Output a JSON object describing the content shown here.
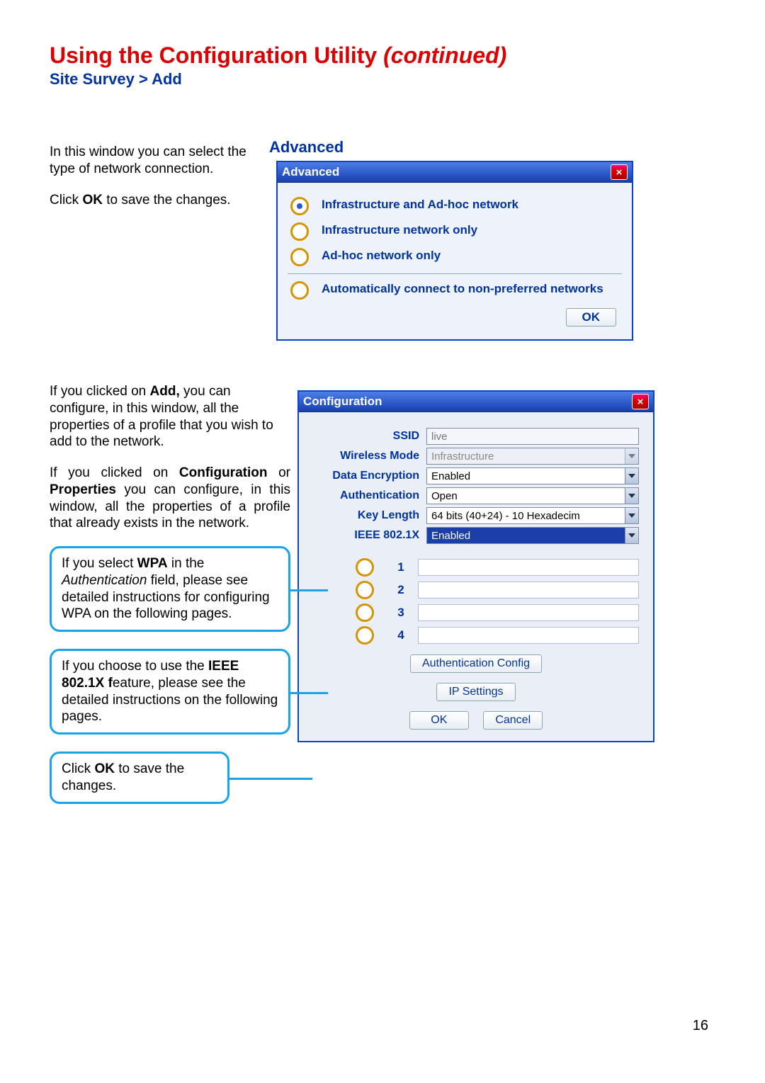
{
  "title_main": "Using the Configuration Utility ",
  "title_italic": "(continued)",
  "breadcrumb": "Site Survey > Add",
  "section_advanced": "Advanced",
  "intro1": "In this window you can select the type of network connection.",
  "intro2_pre": "Click ",
  "intro2_bold": "OK",
  "intro2_post": " to save the changes.",
  "adv": {
    "title": "Advanced",
    "opt1": "Infrastructure and Ad-hoc network",
    "opt2": "Infrastructure  network only",
    "opt3": "Ad-hoc network only",
    "opt4": "Automatically connect to non-preferred networks",
    "ok": "OK"
  },
  "para_add_pre": "If you clicked on ",
  "para_add_bold": "Add,",
  "para_add_post": " you can configure, in this window, all the properties of a profile that you wish to add to the network.",
  "para_cfg_pre": "If you clicked on ",
  "para_cfg_b1": "Configuration",
  "para_cfg_mid": " or ",
  "para_cfg_b2": "Properties",
  "para_cfg_post": " you can configure, in this window, all the properties of a profile that already exists in the network.",
  "callout_wpa_pre": "If you select ",
  "callout_wpa_bold": "WPA",
  "callout_wpa_mid": " in the ",
  "callout_wpa_italic": "Authentication",
  "callout_wpa_post": " field, please see detailed instructions for configuring WPA on the following pages.",
  "callout_ieee_pre": "If you choose to use the ",
  "callout_ieee_bold": "IEEE 802.1X f",
  "callout_ieee_post": "eature, please see the detailed instructions on the following pages.",
  "callout_ok_pre": "Click ",
  "callout_ok_bold": "OK",
  "callout_ok_post": " to save the changes.",
  "cfg": {
    "title": "Configuration",
    "labels": {
      "ssid": "SSID",
      "mode": "Wireless Mode",
      "enc": "Data Encryption",
      "auth": "Authentication",
      "keylen": "Key Length",
      "ieee": "IEEE 802.1X"
    },
    "values": {
      "ssid": "live",
      "mode": "Infrastructure",
      "enc": "Enabled",
      "auth": "Open",
      "keylen": "64 bits (40+24) - 10 Hexadecim",
      "ieee": "Enabled"
    },
    "keys": [
      "1",
      "2",
      "3",
      "4"
    ],
    "btn_authcfg": "Authentication Config",
    "btn_ip": "IP Settings",
    "btn_ok": "OK",
    "btn_cancel": "Cancel"
  },
  "page_number": "16"
}
